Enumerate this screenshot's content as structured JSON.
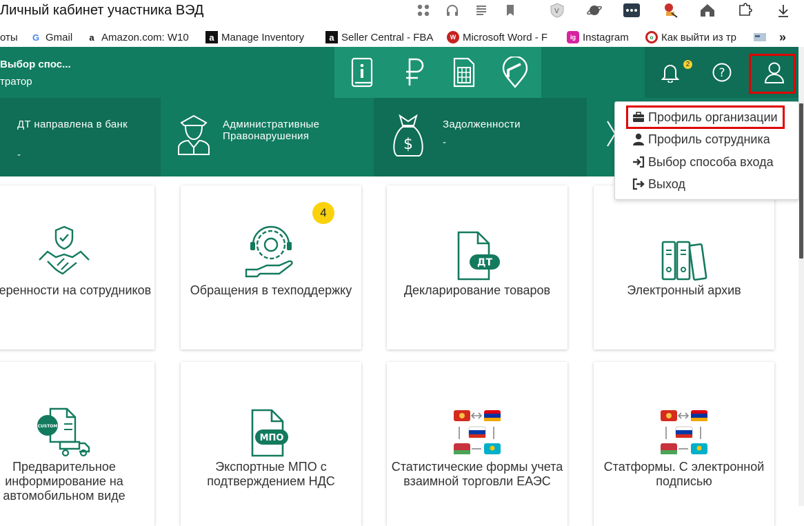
{
  "browser": {
    "title": "Личный кабинет участника ВЭД",
    "bookmarks": [
      {
        "label": "оты",
        "favicon": ""
      },
      {
        "label": "Gmail",
        "favicon": "G"
      },
      {
        "label": "Amazon.com: W10",
        "favicon": "a"
      },
      {
        "label": "Manage Inventory",
        "favicon": "a"
      },
      {
        "label": "Seller Central - FBA",
        "favicon": "a"
      },
      {
        "label": "Microsoft Word - F",
        "favicon": "W"
      },
      {
        "label": "Instagram",
        "favicon": "ig"
      },
      {
        "label": "Как выйти из тр",
        "favicon": "o"
      }
    ],
    "more_label": "»"
  },
  "header": {
    "user_name": "Выбор спос...",
    "user_role": "тратор",
    "bell_badge": "2",
    "quick_icons": [
      "info-book-icon",
      "ruble-icon",
      "calculator-icon",
      "barrier-icon"
    ]
  },
  "stats": [
    {
      "label": "ДТ направлена в банк",
      "value": "-",
      "icon": "bank-icon"
    },
    {
      "label": "Административные Правонарушения",
      "value": "",
      "icon": "officer-icon"
    },
    {
      "label": "Задолженности",
      "value": "-",
      "icon": "money-bag-icon"
    },
    {
      "label": "",
      "value": "",
      "icon": "scales-icon"
    }
  ],
  "dropdown": {
    "items": [
      {
        "label": "Профиль организации",
        "icon": "briefcase-icon"
      },
      {
        "label": "Профиль сотрудника",
        "icon": "person-icon"
      },
      {
        "label": "Выбор способа входа",
        "icon": "sign-in-icon"
      },
      {
        "label": "Выход",
        "icon": "sign-out-icon"
      }
    ]
  },
  "cards": [
    {
      "title": "Доверенности на сотрудников",
      "badge": ""
    },
    {
      "title": "Обращения в техподдержку",
      "badge": "4"
    },
    {
      "title": "Декларирование товаров",
      "badge": "",
      "icon_text": "ДТ"
    },
    {
      "title": "Электронный архив",
      "badge": ""
    },
    {
      "title": "Предварительное информирование на автомобильном виде",
      "badge": "",
      "icon_text": "CUSTOM"
    },
    {
      "title": "Экспортные МПО с подтверждением НДС",
      "badge": "",
      "icon_text": "МПО"
    },
    {
      "title": "Статистические формы учета взаимной торговли ЕАЭС",
      "badge": ""
    },
    {
      "title": "Статформы. С электронной подписью",
      "badge": ""
    }
  ],
  "colors": {
    "primary": "#117c60",
    "accent": "#1c9372",
    "icon": "#137a5e",
    "badge": "#fad20c",
    "highlight": "#e00000"
  }
}
